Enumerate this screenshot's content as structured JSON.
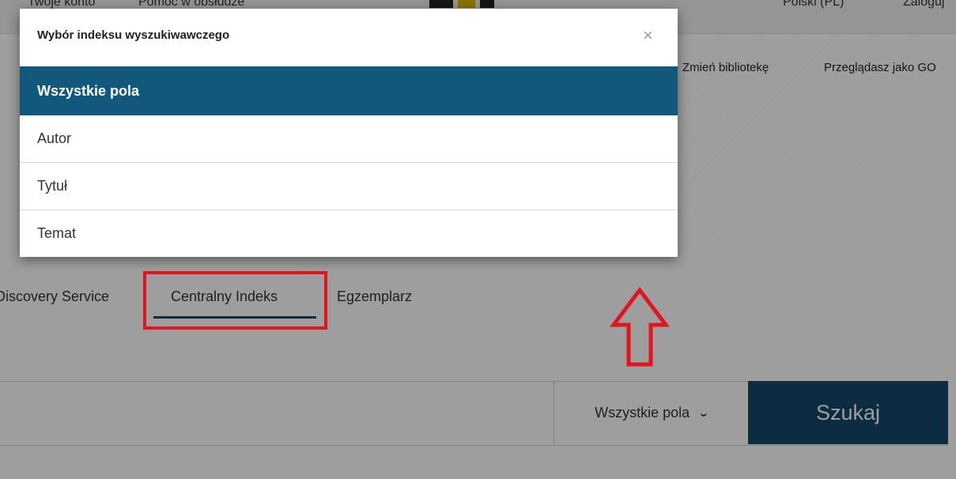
{
  "topbar": {
    "link1": "Twoje konto",
    "link2": "Pomoc w obsłudze",
    "language": "Polski (PL)",
    "login": "Zaloguj"
  },
  "header": {
    "change_library": "Zmień bibliotekę",
    "browsing_as": "Przeglądasz jako GO"
  },
  "tabs": {
    "discovery": "Discovery Service",
    "central_index": "Centralny Indeks",
    "copy": "Egzemplarz"
  },
  "search": {
    "input_value": "",
    "selected_index": "Wszystkie pola",
    "button_label": "Szukaj"
  },
  "dialog": {
    "title": "Wybór indeksu wyszukiwawczego",
    "close_symbol": "×",
    "options": [
      {
        "label": "Wszystkie pola",
        "selected": true
      },
      {
        "label": "Autor",
        "selected": false
      },
      {
        "label": "Tytuł",
        "selected": false
      },
      {
        "label": "Temat",
        "selected": false
      }
    ]
  },
  "colors": {
    "accent": "#12587d",
    "button": "#12486a",
    "annotation": "#e0161e"
  },
  "icons": {
    "close": "close-icon",
    "chevron": "chevron-down-icon",
    "arrow": "arrow-up-icon"
  }
}
